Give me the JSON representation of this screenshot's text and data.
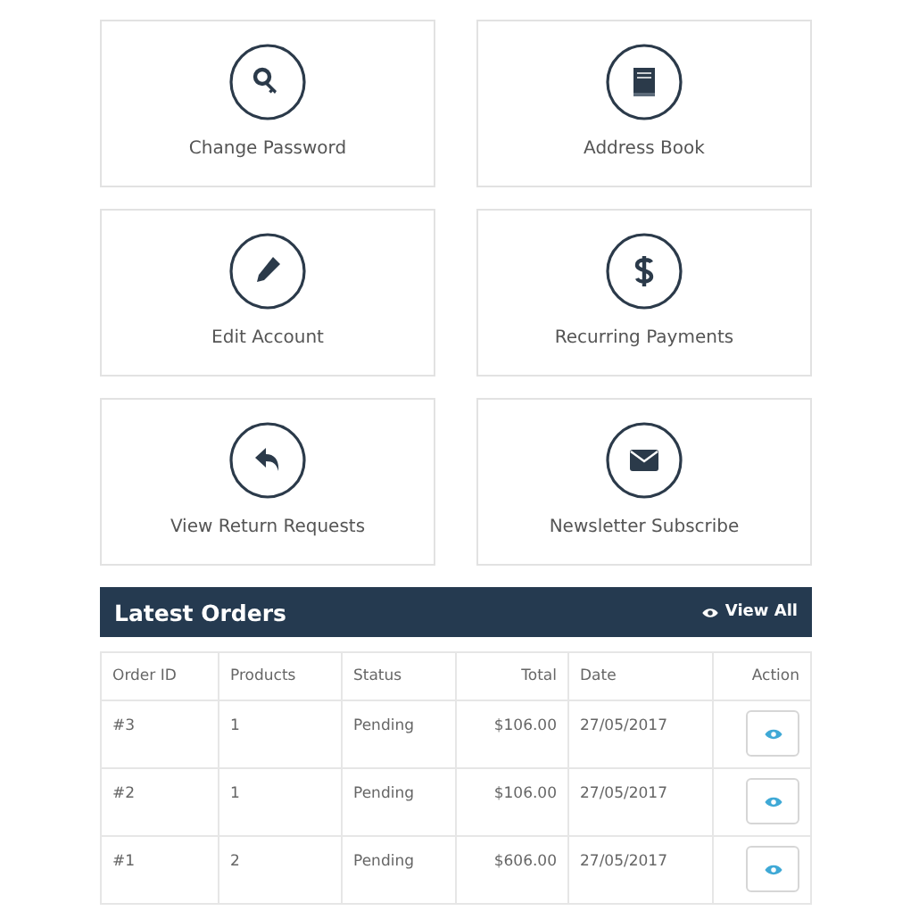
{
  "tiles": [
    {
      "label": "Change Password",
      "kind": "key"
    },
    {
      "label": "Address Book",
      "kind": "book"
    },
    {
      "label": "Edit Account",
      "kind": "pencil"
    },
    {
      "label": "Recurring Payments",
      "kind": "dollar"
    },
    {
      "label": "View Return Requests",
      "kind": "reply"
    },
    {
      "label": "Newsletter Subscribe",
      "kind": "envelope"
    }
  ],
  "latest_orders": {
    "title": "Latest Orders",
    "view_all": "View All",
    "columns": [
      "Order ID",
      "Products",
      "Status",
      "Total",
      "Date",
      "Action"
    ],
    "rows": [
      [
        "#3",
        "1",
        "Pending",
        "$106.00",
        "27/05/2017"
      ],
      [
        "#2",
        "1",
        "Pending",
        "$106.00",
        "27/05/2017"
      ],
      [
        "#1",
        "2",
        "Pending",
        "$606.00",
        "27/05/2017"
      ]
    ]
  }
}
